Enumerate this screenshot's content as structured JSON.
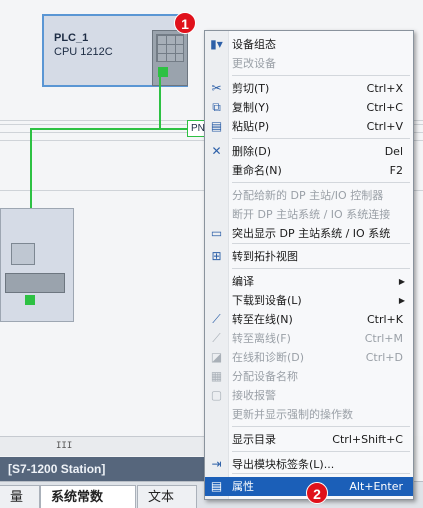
{
  "device": {
    "name": "PLC_1",
    "type": "CPU 1212C",
    "port_tag": "PN"
  },
  "station": {
    "title": "[S7-1200 Station]"
  },
  "tabs": [
    {
      "label": "量"
    },
    {
      "label": "系统常数"
    },
    {
      "label": "文本"
    }
  ],
  "scrollbar": {
    "grip": "III"
  },
  "menu": {
    "items": [
      {
        "label": "设备组态",
        "shortcut": "",
        "icon": "device-config-icon",
        "glyph": "▮▾",
        "disabled": false
      },
      {
        "label": "更改设备",
        "shortcut": "",
        "icon": "",
        "glyph": "",
        "disabled": true
      },
      {
        "label": "剪切(T)",
        "shortcut": "Ctrl+X",
        "icon": "scissors-icon",
        "glyph": "✂",
        "disabled": false
      },
      {
        "label": "复制(Y)",
        "shortcut": "Ctrl+C",
        "icon": "copy-icon",
        "glyph": "⧉",
        "disabled": false
      },
      {
        "label": "粘贴(P)",
        "shortcut": "Ctrl+V",
        "icon": "paste-icon",
        "glyph": "▤",
        "disabled": false
      },
      {
        "label": "删除(D)",
        "shortcut": "Del",
        "icon": "delete-icon",
        "glyph": "✕",
        "disabled": false
      },
      {
        "label": "重命名(N)",
        "shortcut": "F2",
        "icon": "",
        "glyph": "",
        "disabled": false
      },
      {
        "label": "分配给新的 DP 主站/IO 控制器",
        "shortcut": "",
        "icon": "",
        "glyph": "",
        "disabled": true
      },
      {
        "label": "断开 DP 主站系统 / IO 系统连接",
        "shortcut": "",
        "icon": "",
        "glyph": "",
        "disabled": true
      },
      {
        "label": "突出显示 DP 主站系统 / IO 系统",
        "shortcut": "",
        "icon": "highlight-icon",
        "glyph": "▭",
        "disabled": false
      },
      {
        "label": "转到拓扑视图",
        "shortcut": "",
        "icon": "topology-icon",
        "glyph": "⊞",
        "disabled": false
      },
      {
        "label": "编译",
        "shortcut": "",
        "icon": "",
        "glyph": "",
        "disabled": false,
        "submenu": true
      },
      {
        "label": "下载到设备(L)",
        "shortcut": "",
        "icon": "",
        "glyph": "",
        "disabled": false,
        "submenu": true
      },
      {
        "label": "转至在线(N)",
        "shortcut": "Ctrl+K",
        "icon": "go-online-icon",
        "glyph": "⟋",
        "disabled": false
      },
      {
        "label": "转至离线(F)",
        "shortcut": "Ctrl+M",
        "icon": "go-offline-icon",
        "glyph": "⟋",
        "disabled": true
      },
      {
        "label": "在线和诊断(D)",
        "shortcut": "Ctrl+D",
        "icon": "diagnostics-icon",
        "glyph": "◪",
        "disabled": true
      },
      {
        "label": "分配设备名称",
        "shortcut": "",
        "icon": "assign-name-icon",
        "glyph": "▦",
        "disabled": true
      },
      {
        "label": "接收报警",
        "shortcut": "",
        "icon": "alarm-icon",
        "glyph": "▢",
        "disabled": true
      },
      {
        "label": "更新并显示强制的操作数",
        "shortcut": "",
        "icon": "",
        "glyph": "",
        "disabled": true
      },
      {
        "label": "显示目录",
        "shortcut": "Ctrl+Shift+C",
        "icon": "",
        "glyph": "",
        "disabled": false
      },
      {
        "label": "导出模块标签条(L)...",
        "shortcut": "",
        "icon": "export-icon",
        "glyph": "⇥",
        "disabled": false
      },
      {
        "label": "属性",
        "shortcut": "Alt+Enter",
        "icon": "properties-icon",
        "glyph": "▤",
        "disabled": false,
        "highlighted": true
      }
    ]
  },
  "callouts": [
    "1",
    "2"
  ],
  "colors": {
    "accent": "#1b5fb8",
    "badge": "#e0111b",
    "link_green": "#2dc143"
  }
}
